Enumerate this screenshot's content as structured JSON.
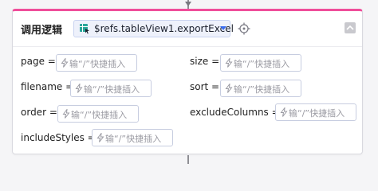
{
  "card": {
    "title": "调用逻辑",
    "method": "$refs.tableView1.exportExcel",
    "accent_color": "#ef4e9a"
  },
  "icons": {
    "method": "table-cursor-icon",
    "target": "crosshair-icon",
    "collapse": "chevron-up-icon",
    "input": "lightning-icon"
  },
  "params": [
    {
      "label": "page =",
      "placeholder": "输“/”快捷插入"
    },
    {
      "label": "size =",
      "placeholder": "输“/”快捷插入"
    },
    {
      "label": "filename =",
      "placeholder": "输“/”快捷插入"
    },
    {
      "label": "sort =",
      "placeholder": "输“/”快捷插入"
    },
    {
      "label": "order =",
      "placeholder": "输“/”快捷插入"
    },
    {
      "label": "excludeColumns =",
      "placeholder": "输“/”快捷插入"
    },
    {
      "label": "includeStyles =",
      "placeholder": "输“/”快捷插入"
    }
  ]
}
